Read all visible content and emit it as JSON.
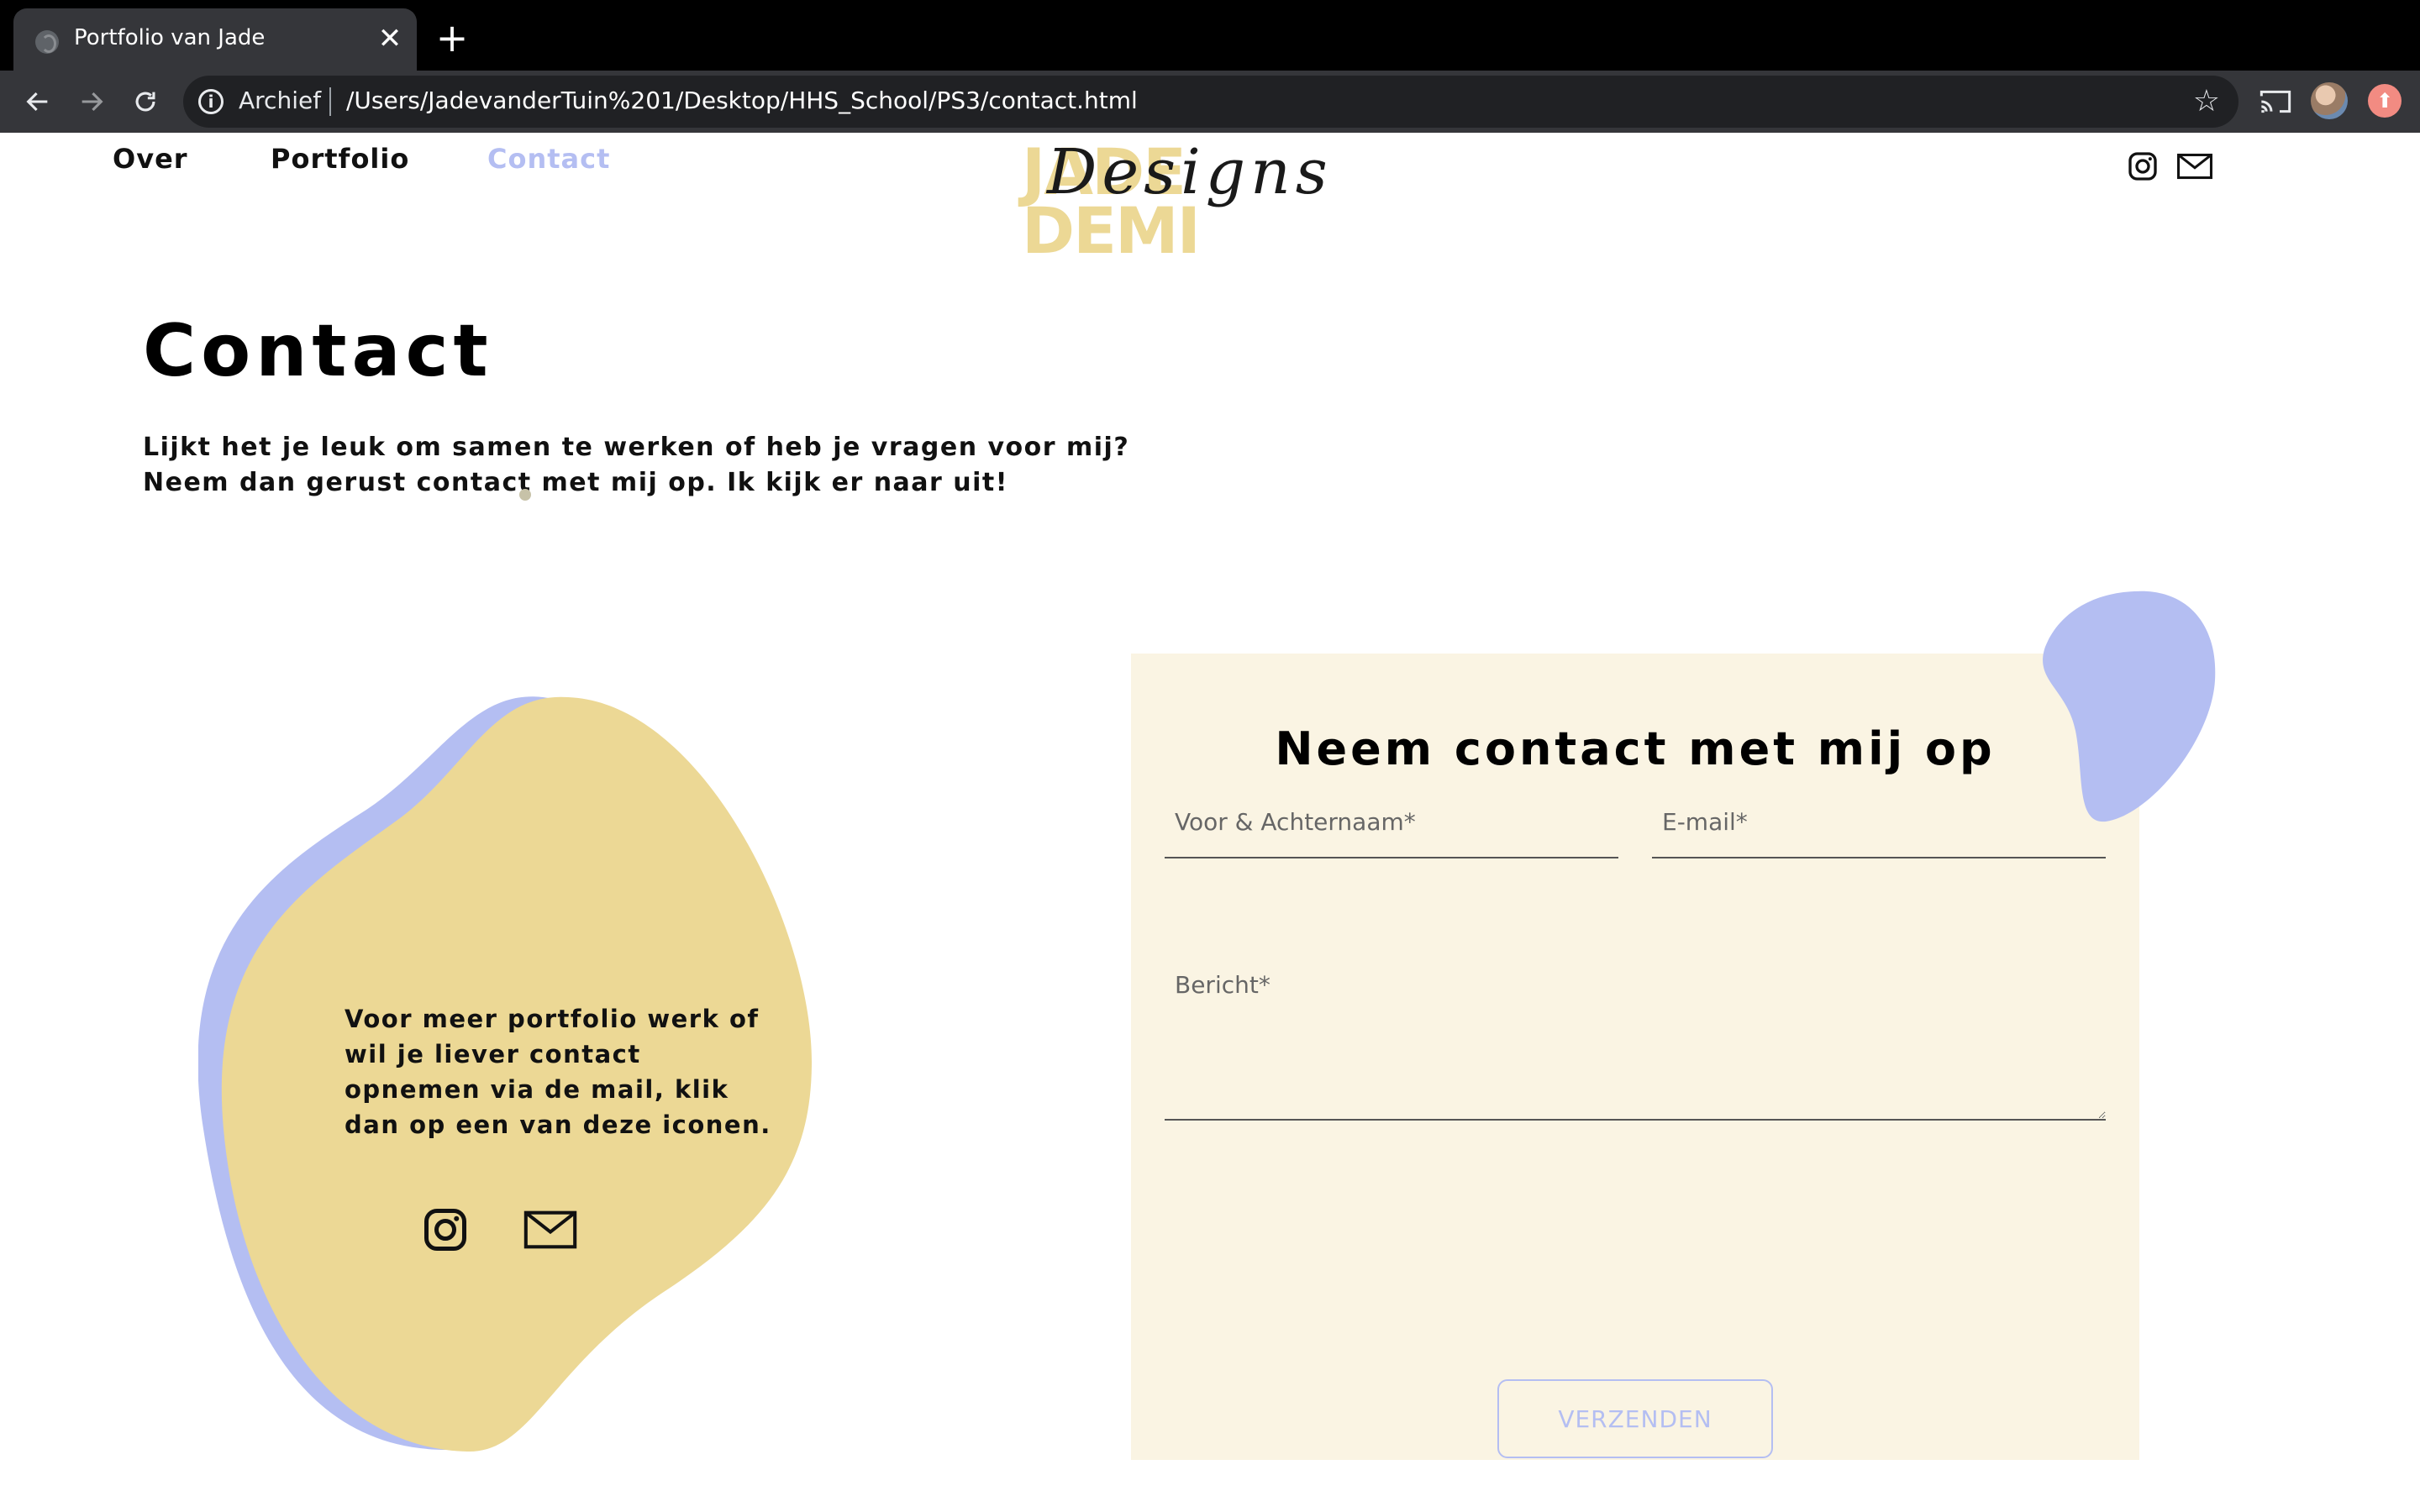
{
  "browser": {
    "tab_title": "Portfolio van Jade",
    "tab_close": "✕",
    "new_tab": "+",
    "address_chip": "Archief",
    "url": "/Users/JadevanderTuin%201/Desktop/HHS_School/PS3/contact.html"
  },
  "nav": {
    "items": [
      {
        "label": "Over"
      },
      {
        "label": "Portfolio"
      },
      {
        "label": "Contact"
      }
    ]
  },
  "logo": {
    "block_text": "JADE DEMI",
    "script_text": "Designs"
  },
  "main": {
    "title": "Contact",
    "intro_line1": "Lijkt het je leuk om samen te werken of heb je vragen voor mij?",
    "intro_line2": "Neem dan gerust contact met mij op. Ik kijk er naar uit!"
  },
  "blob": {
    "text": "Voor meer portfolio werk of wil je liever contact opnemen via de mail, klik dan op een van deze iconen."
  },
  "form": {
    "title": "Neem contact met mij op",
    "name_placeholder": "Voor & Achternaam*",
    "email_placeholder": "E-mail*",
    "message_placeholder": "Bericht*",
    "submit_label": "VERZENDEN"
  },
  "colors": {
    "accent_blue": "#b4bef2",
    "accent_yellow": "#ecd895",
    "form_background": "#faf4e3"
  },
  "icons": [
    "globe-icon",
    "back-icon",
    "forward-icon",
    "reload-icon",
    "info-icon",
    "star-icon",
    "cast-icon",
    "instagram-icon",
    "mail-icon"
  ]
}
